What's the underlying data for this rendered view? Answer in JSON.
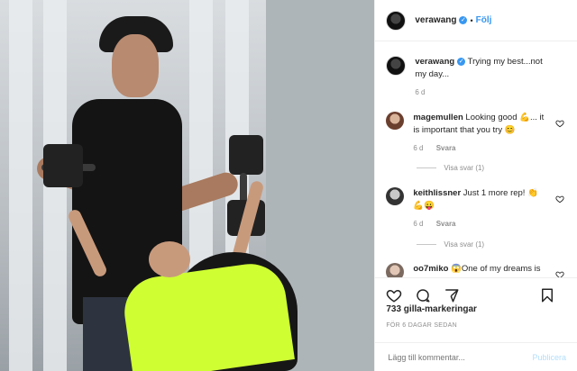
{
  "header": {
    "username": "verawang",
    "separator": "•",
    "follow_label": "Följ"
  },
  "caption": {
    "username": "verawang",
    "text": "Trying my best...not my day...",
    "age": "6 d"
  },
  "comments": [
    {
      "username": "magemullen",
      "text": "Looking good 💪... it is important that you try 😊",
      "age": "6 d",
      "reply_label": "Svara",
      "view_replies": "Visa svar (1)"
    },
    {
      "username": "keithlissner",
      "text": "Just 1 more rep! 👏 💪😛",
      "age": "6 d",
      "reply_label": "Svara",
      "view_replies": "Visa svar (1)"
    },
    {
      "username": "oo7miko",
      "text": "😱One of my dreams is"
    }
  ],
  "likes": "733 gilla-markeringar",
  "date": "FÖR 6 DAGAR SEDAN",
  "add_comment": {
    "placeholder": "Lägg till kommentar...",
    "publish_label": "Publicera"
  },
  "icons": {
    "verified": "verified-badge-icon",
    "heart": "heart-icon",
    "comment": "comment-icon",
    "share": "share-icon",
    "bookmark": "bookmark-icon"
  },
  "colors": {
    "link_blue": "#3897f0",
    "publish_disabled": "#b2dffc",
    "meta_gray": "#8e8e8e"
  }
}
